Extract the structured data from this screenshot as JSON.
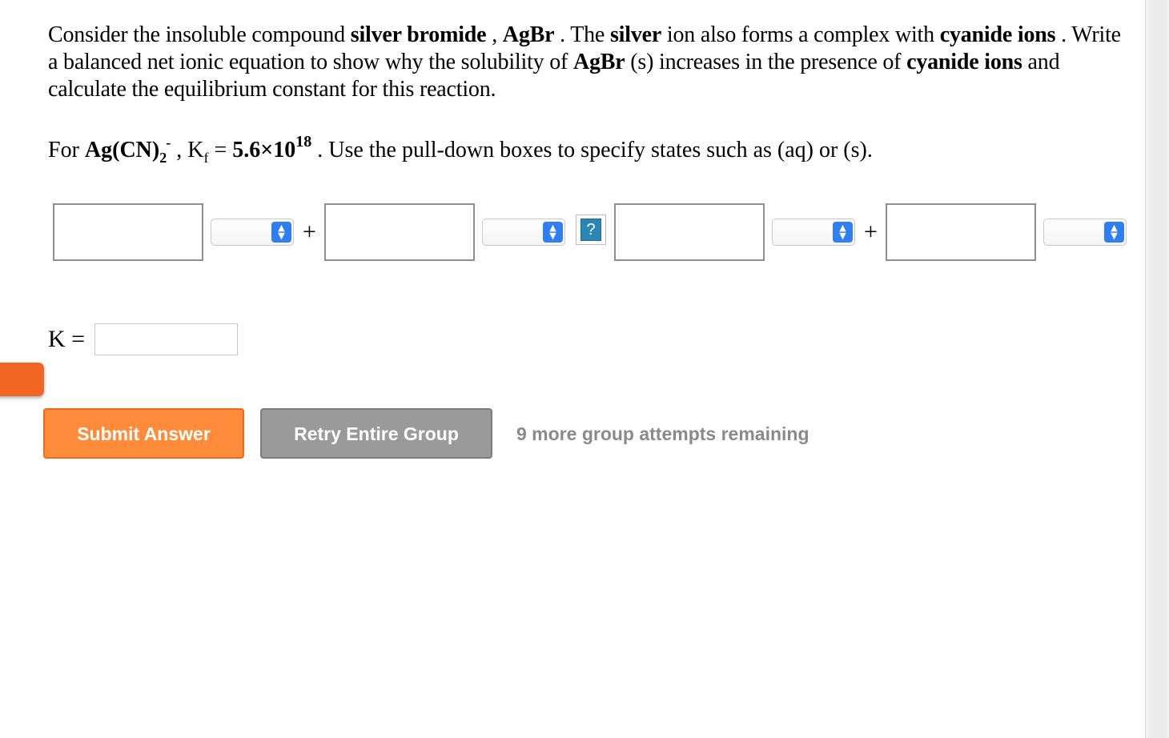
{
  "question": {
    "p1": "Consider the insoluble compound ",
    "b1": "silver bromide",
    "p2": " , ",
    "b2": "AgBr",
    "p3": " . The ",
    "b3": "silver",
    "p4": " ion also forms a complex with ",
    "b4": "cyanide ions",
    "p5": " . Write a balanced net ionic equation to show why the solubility of ",
    "b5": "AgBr",
    "p6": " (s) increases in the presence of ",
    "b6": "cyanide ions",
    "p7": " and calculate the equilibrium constant for this reaction."
  },
  "kf_line": {
    "prefix": "For ",
    "complex_main": "Ag(CN)",
    "complex_sub": "2",
    "complex_charge": "-",
    "mid": " , K",
    "kf_sub": "f",
    "equals": " = ",
    "value_base": "5.6×10",
    "value_exp": "18",
    "suffix": " . Use the pull-down boxes to specify states such as (aq) or (s)."
  },
  "equation": {
    "plus_1": "+",
    "plus_2": "+",
    "arrow_placeholder": "?",
    "state_selects": [
      "",
      "",
      "",
      ""
    ],
    "species_inputs": [
      "",
      "",
      "",
      ""
    ]
  },
  "k_field": {
    "label": "K =",
    "value": ""
  },
  "buttons": {
    "submit": "Submit Answer",
    "retry": "Retry Entire Group"
  },
  "status": {
    "attempts": "9 more group attempts remaining"
  },
  "colors": {
    "submit_bg": "#ff8c3a",
    "retry_bg": "#9a9a9a",
    "select_arrow": "#2f7ff2",
    "help_icon": "#2b86b6",
    "side_tab": "#f26522"
  }
}
